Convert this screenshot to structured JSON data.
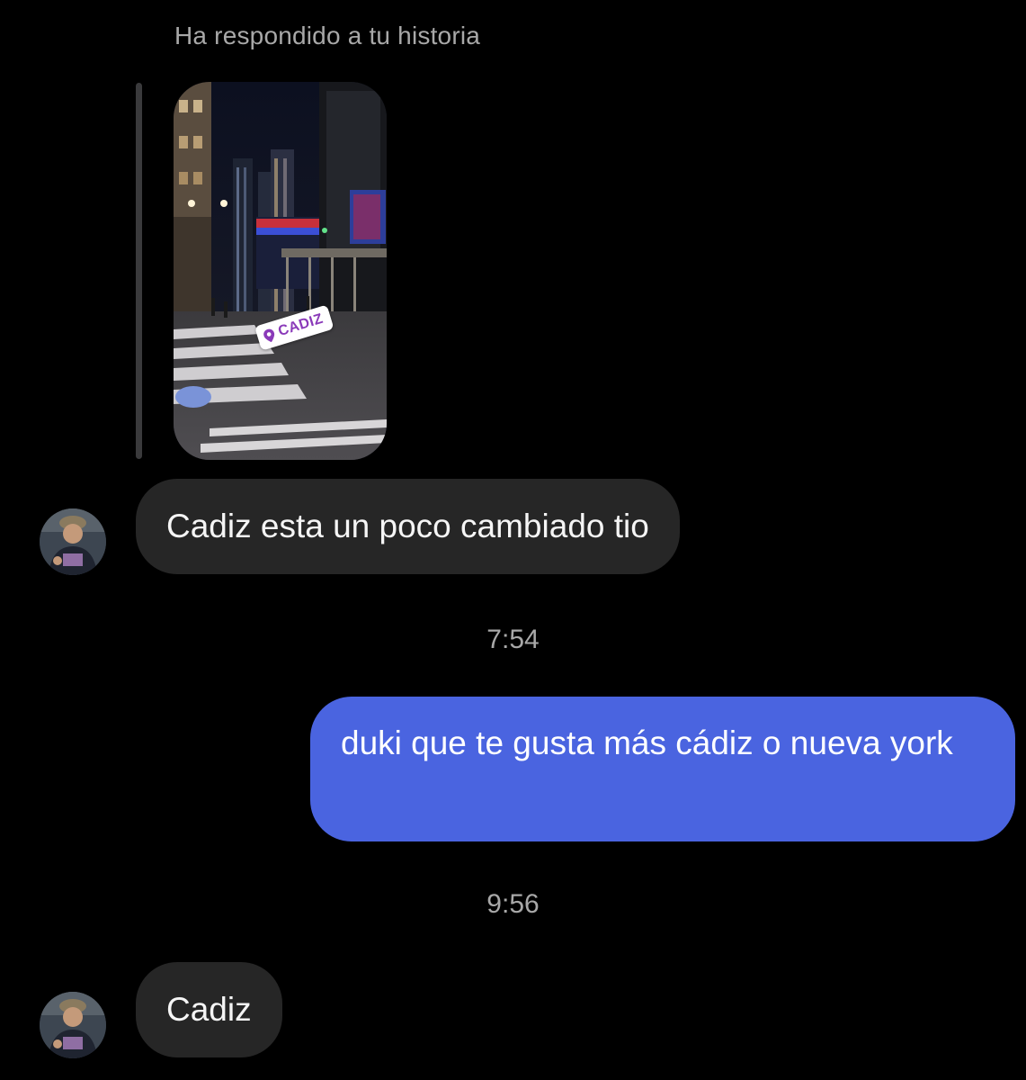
{
  "story_reply": {
    "label": "Ha respondido a tu historia",
    "sticker_text": "CADIZ",
    "sticker_icon": "location-pin-icon"
  },
  "messages": [
    {
      "from": "them",
      "text": "Cadiz esta un poco cambiado tio"
    },
    {
      "from": "me",
      "text": "duki que te gusta más cádiz o nueva york"
    },
    {
      "from": "them",
      "text": "Cadiz"
    }
  ],
  "timestamps": [
    "7:54",
    "9:56"
  ],
  "colors": {
    "background": "#000000",
    "incoming_bubble": "#262626",
    "outgoing_bubble": "#4a64e0",
    "meta_text": "#a8a8a8",
    "sticker_accent": "#8a3ab9"
  }
}
